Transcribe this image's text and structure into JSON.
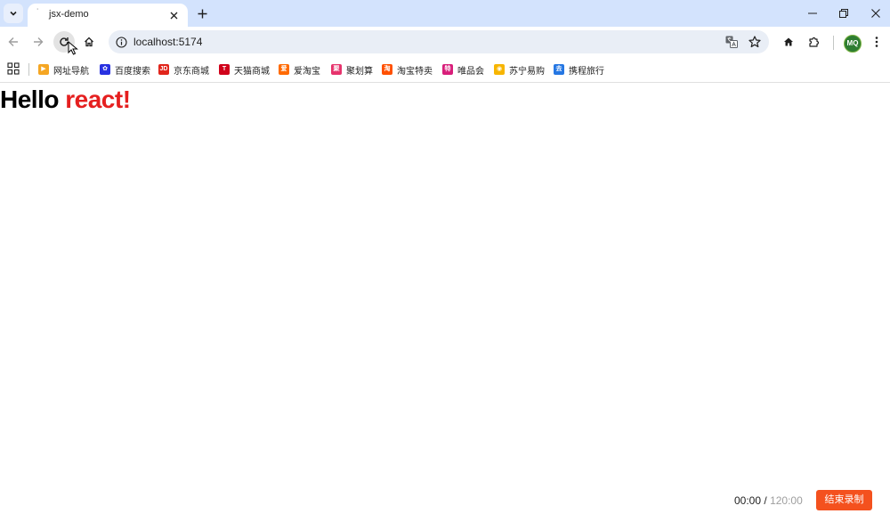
{
  "browser": {
    "tab_title": "jsx-demo",
    "url": "localhost:5174",
    "profile_initials": "MQ"
  },
  "bookmarks": [
    {
      "label": "网址导航",
      "icon": "hao123-icon",
      "color": "#f5a623",
      "glyph": "▶"
    },
    {
      "label": "百度搜索",
      "icon": "baidu-paw-icon",
      "color": "#2932e1",
      "glyph": "✿"
    },
    {
      "label": "京东商城",
      "icon": "jd-icon",
      "color": "#e1251b",
      "glyph": "JD"
    },
    {
      "label": "天猫商城",
      "icon": "tmall-icon",
      "color": "#d0021b",
      "glyph": "T"
    },
    {
      "label": "爱淘宝",
      "icon": "ai-taobao-icon",
      "color": "#ff6a00",
      "glyph": "爱"
    },
    {
      "label": "聚划算",
      "icon": "juhuasuan-icon",
      "color": "#e6336c",
      "glyph": "聚"
    },
    {
      "label": "淘宝特卖",
      "icon": "taobao-sale-icon",
      "color": "#ff5000",
      "glyph": "淘"
    },
    {
      "label": "唯品会",
      "icon": "vip-icon",
      "color": "#d81e7a",
      "glyph": "特"
    },
    {
      "label": "苏宁易购",
      "icon": "suning-icon",
      "color": "#f7b500",
      "glyph": "◉"
    },
    {
      "label": "携程旅行",
      "icon": "ctrip-icon",
      "color": "#2577e3",
      "glyph": "去"
    }
  ],
  "page": {
    "heading_prefix": "Hello",
    "heading_accent": "react!"
  },
  "recorder": {
    "elapsed": "00:00",
    "separator": "/",
    "total": "120:00",
    "stop_label": "结束录制"
  },
  "colors": {
    "accent_red": "#e51f1f",
    "record_button": "#f4511e",
    "tabstrip": "#d3e3fd"
  }
}
